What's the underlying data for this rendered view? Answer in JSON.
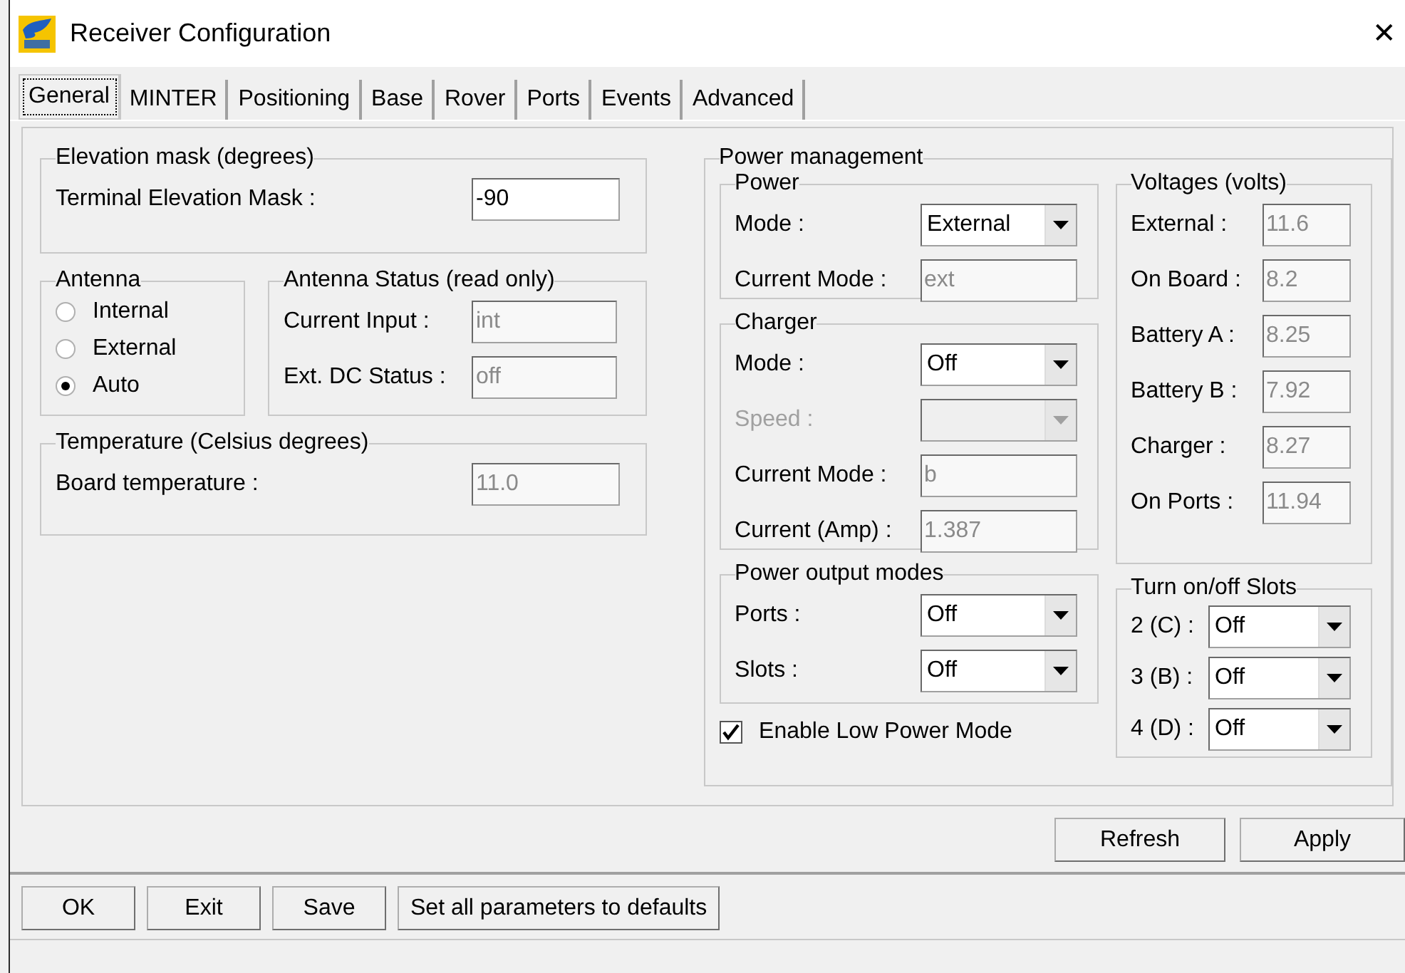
{
  "window": {
    "title": "Receiver Configuration",
    "close": "✕"
  },
  "tabs": [
    {
      "label": "General",
      "selected": true
    },
    {
      "label": "MINTER",
      "selected": false
    },
    {
      "label": "Positioning",
      "selected": false
    },
    {
      "label": "Base",
      "selected": false
    },
    {
      "label": "Rover",
      "selected": false
    },
    {
      "label": "Ports",
      "selected": false
    },
    {
      "label": "Events",
      "selected": false
    },
    {
      "label": "Advanced",
      "selected": false
    }
  ],
  "elevation": {
    "title": "Elevation mask (degrees)",
    "label": "Terminal Elevation Mask :",
    "value": "-90",
    "readonly": false
  },
  "antenna": {
    "title": "Antenna",
    "options": [
      {
        "label": "Internal",
        "selected": false
      },
      {
        "label": "External",
        "selected": false
      },
      {
        "label": "Auto",
        "selected": true
      }
    ]
  },
  "antenna_status": {
    "title": "Antenna Status (read only)",
    "fields": [
      {
        "label": "Current Input :",
        "value": "int",
        "readonly": true
      },
      {
        "label": "Ext. DC Status :",
        "value": "off",
        "readonly": true
      }
    ]
  },
  "temperature": {
    "title": "Temperature (Celsius degrees)",
    "label": "Board temperature :",
    "value": "11.0",
    "readonly": true
  },
  "power_management": {
    "title": "Power management",
    "power": {
      "title": "Power",
      "rows": [
        {
          "kind": "combo",
          "label": "Mode :",
          "value": "External",
          "disabled": false
        },
        {
          "kind": "field",
          "label": "Current Mode :",
          "value": "ext",
          "readonly": true
        }
      ]
    },
    "charger": {
      "title": "Charger",
      "rows": [
        {
          "kind": "combo",
          "label": "Mode :",
          "value": "Off",
          "disabled": false
        },
        {
          "kind": "combo",
          "label": "Speed :",
          "disabled": true
        },
        {
          "kind": "field",
          "label": "Current Mode :",
          "value": "b",
          "readonly": true
        },
        {
          "kind": "field",
          "label": "Current (Amp) :",
          "value": "1.387",
          "readonly": true
        }
      ]
    },
    "output_modes": {
      "title": "Power output modes",
      "rows": [
        {
          "kind": "combo",
          "label": "Ports :",
          "value": "Off",
          "disabled": false
        },
        {
          "kind": "combo",
          "label": "Slots :",
          "value": "Off",
          "disabled": false
        }
      ]
    },
    "low_power": {
      "label": "Enable Low Power Mode",
      "checked": true
    },
    "voltages": {
      "title": "Voltages (volts)",
      "rows": [
        {
          "label": "External :",
          "value": "11.6",
          "readonly": true
        },
        {
          "label": "On Board :",
          "value": "8.2",
          "readonly": true
        },
        {
          "label": "Battery A :",
          "value": "8.25",
          "readonly": true
        },
        {
          "label": "Battery B :",
          "value": "7.92",
          "readonly": true
        },
        {
          "label": "Charger :",
          "value": "8.27",
          "readonly": true
        },
        {
          "label": "On Ports :",
          "value": "11.94",
          "readonly": true
        }
      ]
    },
    "slots": {
      "title": "Turn on/off Slots",
      "rows": [
        {
          "label": "2 (C) :",
          "value": "Off",
          "disabled": false
        },
        {
          "label": "3 (B) :",
          "value": "Off",
          "disabled": false
        },
        {
          "label": "4 (D) :",
          "value": "Off",
          "disabled": false
        }
      ]
    }
  },
  "panel_buttons": [
    "Refresh",
    "Apply"
  ],
  "bottom_buttons": [
    "OK",
    "Exit",
    "Save",
    "Set all parameters to defaults"
  ]
}
